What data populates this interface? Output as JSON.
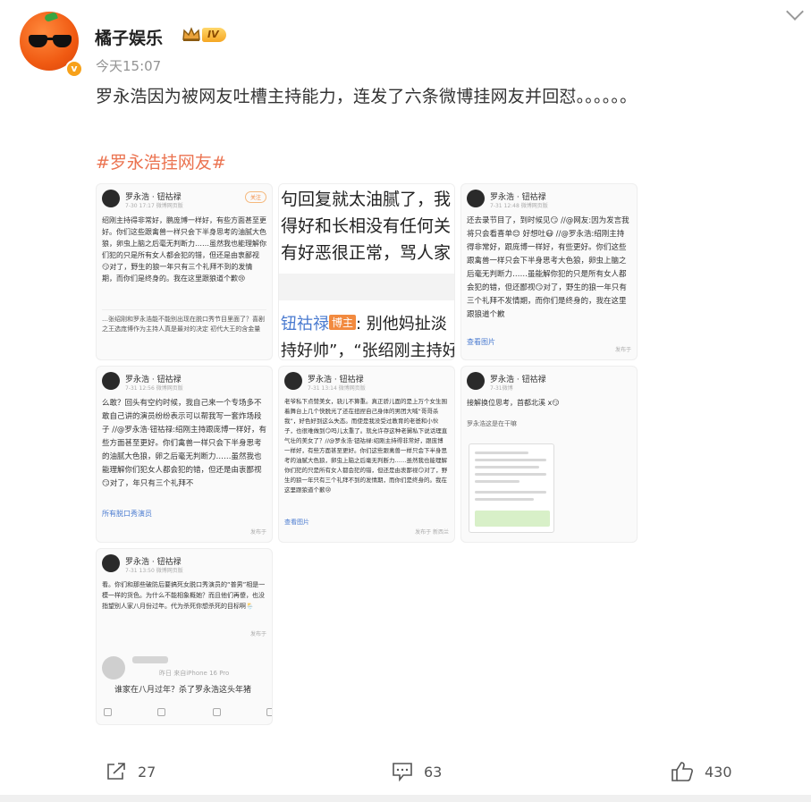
{
  "post": {
    "username": "橘子娱乐",
    "level_badge": "IV",
    "verified_mark": "v",
    "time": "今天15:07",
    "text": "罗永浩因为被网友吐槽主持能力，连发了六条微博挂网友并回怼。。。。。。",
    "hashtag": "#罗永浩挂网友#"
  },
  "images": {
    "t1": {
      "author": "罗永浩 · 钮祜禄",
      "time": "7-30 17:17  微博网页版",
      "follow": "关注",
      "body": "绍刚主持得非常好，鹏庞博一样好，有些方面甚至更好。你们这些跟禽兽一样只会下半身思考的油腻大色狼，卵虫上脑之后毫无判断力……虽然我也能理解你们犯的只是所有女人都会犯的错，但还是由衷鄙视😏对了，野生的狼一年只有三个礼拜不到的发情期，而你们是终身的。我在这里跟狼道个歉😢",
      "extra": "…张绍刚和罗永浩能不能别出现在脱口秀节目里面了？喜剧之王选庞博作为主持人真是最对的决定 初代大王的含金量",
      "foot": "发布于"
    },
    "t2": {
      "line1": "句回复就太油腻了，我",
      "line2": "得好和长相没有任何关",
      "line3": "有好恶很正常，骂人家",
      "name": "钮祜禄",
      "badge": "博主",
      "line4": ": 别他妈扯淡",
      "line5": "持好帅”，“张绍刚主持好"
    },
    "t3": {
      "author": "罗永浩 · 钮祜禄",
      "time": "7-31 12:48  微博网页版",
      "body": "还去录节目了，到时候见😏 //@网友:因为发言我将只会看喜单😊 好想吐😷 //@罗永浩:绍刚主持得非常好，跟庞博一样好，有些更好。你们这些跟禽兽一样只会下半身思考大色狼，卵虫上脑之后毫无判断力……虽能解你犯的只是所有女人都会犯的错，但还鄙视😏对了，野生的狼一年只有三个礼拜不发情期，而你们是终身的，我在这里跟狼道个歉",
      "more": "查看图片",
      "foot": "发布于"
    },
    "t4": {
      "author": "罗永浩 · 钮祜禄",
      "time": "7-31 12:56  微博网页版",
      "body": "么敢？回头有空约时候，我自己来一个专场多不敢自己讲的演员纷纷表示可以帮我写一套炸场段子 //@罗永浩·钮祜禄:绍刚主持跟庞博一样好，有些方面甚至更好。你们禽兽一样只会下半身思考的油腻大色狼，卵之后毫无判断力……虽然我也能理解你们犯女人都会犯的错，但还是由衷鄙视😏对了，年只有三个礼拜不",
      "link": "所有脱口秀演员",
      "foot": "发布于"
    },
    "t5": {
      "author": "罗永浩 · 钮祜禄",
      "time": "7-31 13:14  微博网页版",
      "body": "老爷私下点赞美女，骁儿不算重。真正骄儿面的是上万个女生围着舞台上几个快脱光了还在扭捏自己身体的男团大喊“哥哥杀我”，好色好到这么失态。而使是我没受过教育的老爸和小伙子，也很难做到😏吗儿太重了。就允许存这种老舅私下说话理直气壮的美女了？//@罗永浩·钮祜禄:绍刚主持得非常好，跟庞博一样好，有些方面甚至更好。你们这些跟禽兽一样只会下半身思考的油腻大色狼，卵虫上脑之后毫无判断力……虽然我也能理解你们犯的只是所有女人都会犯的错，但还是由衷鄙视😏对了，野生的狼一年只有三个礼拜不到的发情期，而你们是终身的。我在这里跟狼道个歉😢",
      "more": "查看图片",
      "foot": "发布于  新西兰"
    },
    "t6": {
      "author": "罗永浩 · 钮祜禄",
      "time": "7-31微博",
      "body": "接解换位思考，首都北溪 x😏",
      "sub": "罗永浩这是在干嘛",
      "foot": "发布于"
    },
    "t7": {
      "author": "罗永浩 · 钮祜禄",
      "time": "7-31 13:50  微博网页版",
      "body": "看。你们和那些破防后要搞死女脱口秀演员的“普男”相是一模一样的货色。为什么不能相象概她？而且他们再傻，也没指望别人家八月份过年。代为杀死你想杀死的目标啊🌦️",
      "foot": "发布于",
      "comment_meta": "昨日  来自iPhone 16 Pro",
      "comment": "谁家在八月过年？杀了罗永浩这头年猪"
    }
  },
  "actions": {
    "share_count": "27",
    "comment_count": "63",
    "like_count": "430"
  },
  "colors": {
    "hashtag": "#eb7350",
    "link": "#4a7bd0",
    "time": "#939393",
    "action_text": "#555555"
  }
}
